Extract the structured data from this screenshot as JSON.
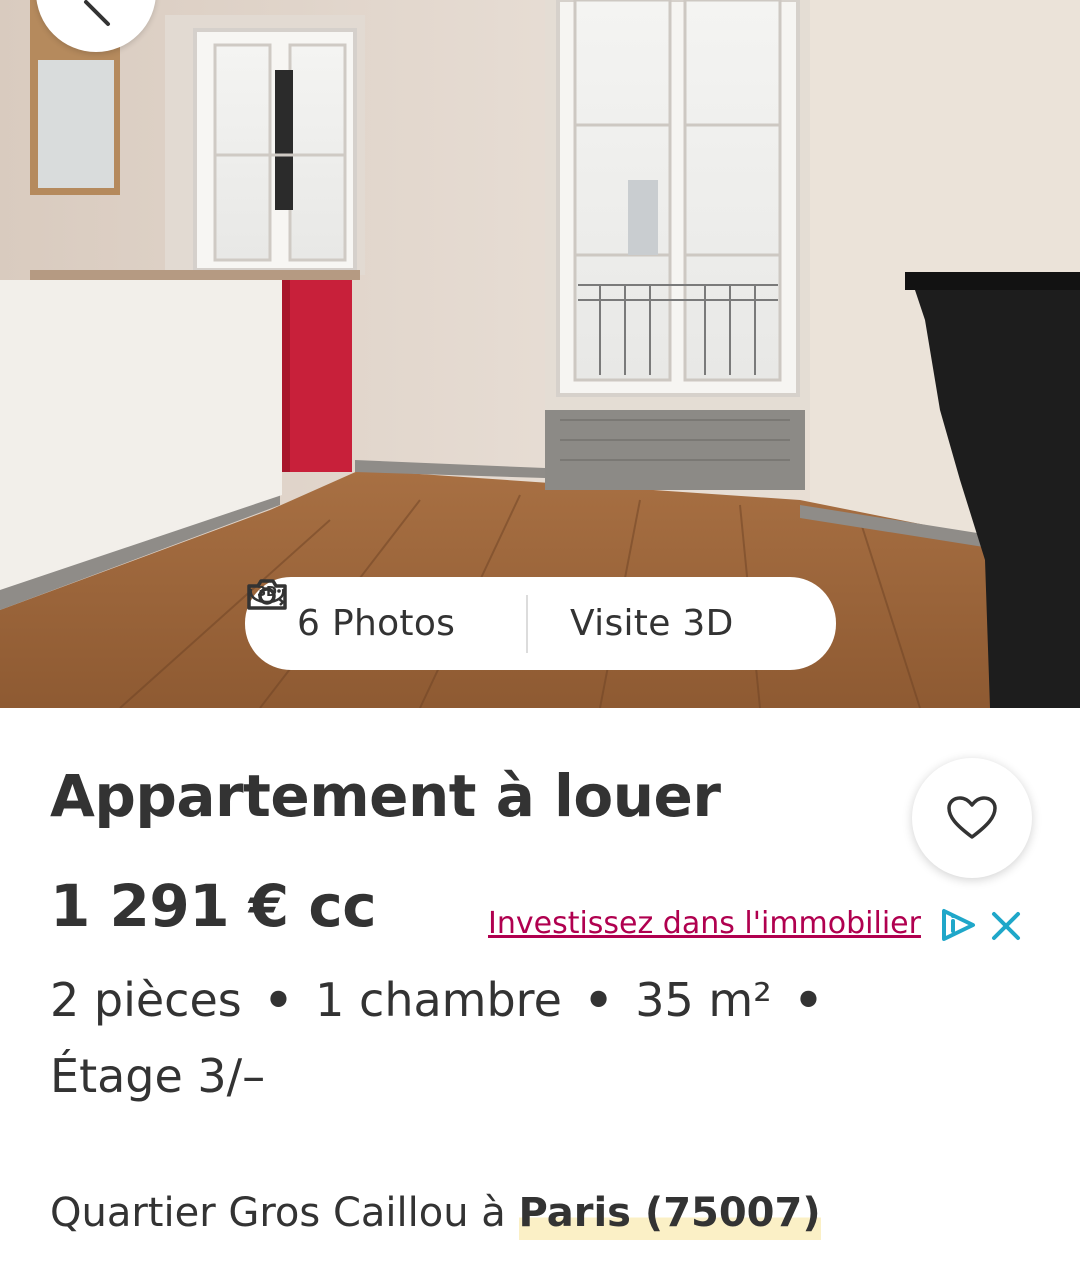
{
  "header": {
    "back_icon": "back-arrow-icon"
  },
  "media": {
    "photos_icon": "camera-icon",
    "photos_label": "6 Photos",
    "visit_icon": "3d-visit-icon",
    "visit_label": "Visite 3D"
  },
  "listing": {
    "title": "Appartement à louer",
    "price": "1 291 € cc",
    "features": [
      "2 pièces",
      "1 chambre",
      "35 m²",
      "Étage 3/–"
    ],
    "location_prefix": "Quartier Gros Caillou à ",
    "location_city": "Paris (75007)"
  },
  "favorite": {
    "icon": "heart-icon"
  },
  "ad": {
    "link_text": "Investissez dans l'immobilier",
    "icon": "adchoices-icon",
    "close_icon": "close-icon",
    "colors": {
      "link": "#b0004f",
      "icon": "#1fa7c9"
    }
  }
}
